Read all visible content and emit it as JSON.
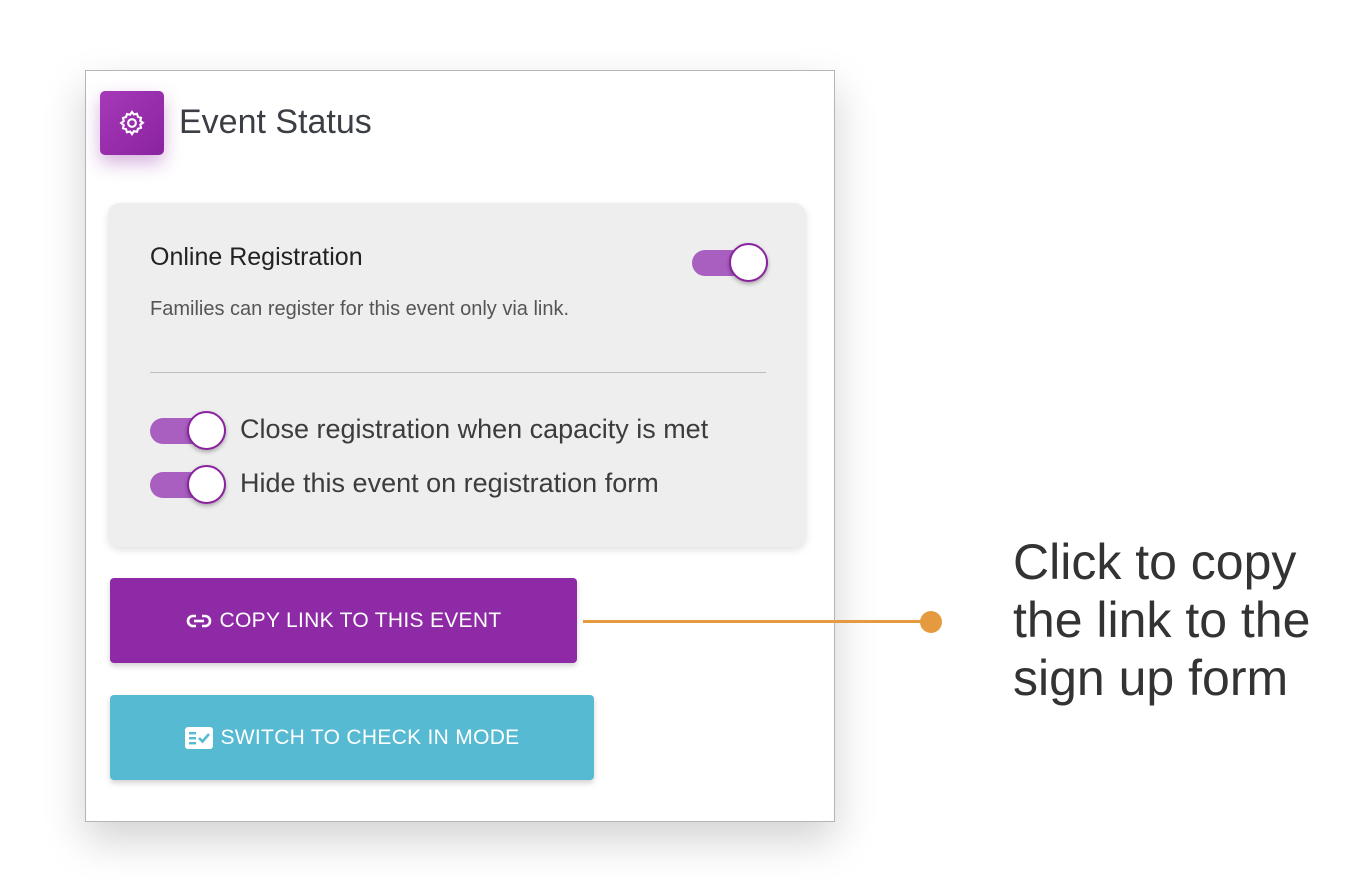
{
  "card": {
    "title": "Event Status",
    "icon": "gear-icon",
    "accent_color": "#8e2aa6"
  },
  "online_registration": {
    "heading": "Online Registration",
    "description": "Families can register for this event only via link.",
    "enabled": true
  },
  "options": [
    {
      "label": "Close registration when capacity is met",
      "enabled": true
    },
    {
      "label": "Hide this event on registration form",
      "enabled": true
    }
  ],
  "buttons": {
    "copy_link": {
      "label": "COPY LINK TO THIS EVENT",
      "icon": "link-icon",
      "color": "#8e2aa6"
    },
    "check_in": {
      "label": "SWITCH TO CHECK IN MODE",
      "icon": "checklist-icon",
      "color": "#56bad3"
    }
  },
  "callout": {
    "lines": [
      "Click to copy",
      "the link to the",
      "sign up form"
    ],
    "color": "#e59a40"
  }
}
